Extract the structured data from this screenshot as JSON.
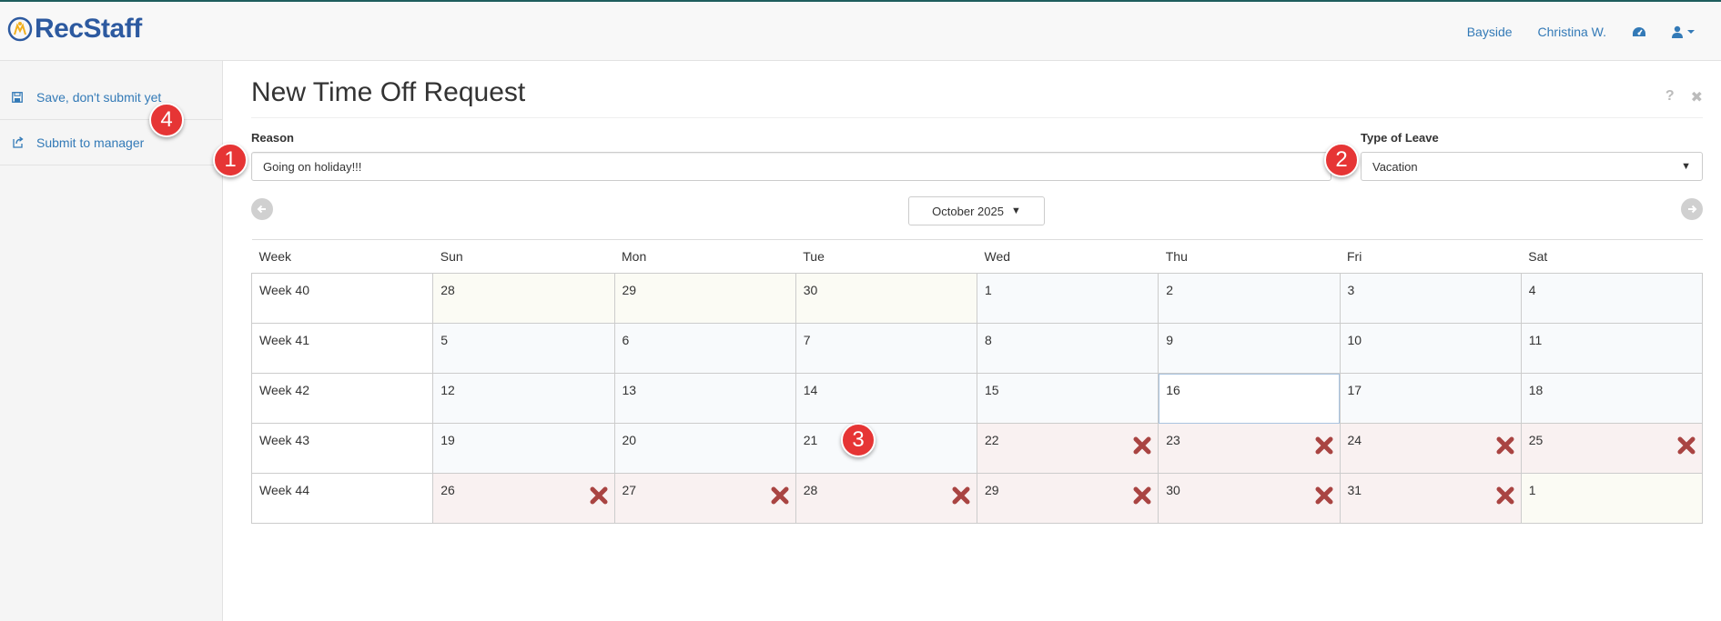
{
  "colors": {
    "link": "#337ab7",
    "brand": "#2d5aa0",
    "time_off_mark": "#a94442",
    "badge": "#e63535"
  },
  "navbar": {
    "brand": "RecStaff",
    "location": "Bayside",
    "user": "Christina W.",
    "icons": [
      "dashboard-icon",
      "user-icon",
      "caret-down-icon"
    ]
  },
  "sidebar": {
    "items": [
      {
        "label": "Save, don't submit yet",
        "icon": "floppy-disk-icon"
      },
      {
        "label": "Submit to manager",
        "icon": "share-icon"
      }
    ]
  },
  "form": {
    "title": "New Time Off Request",
    "reason_label": "Reason",
    "reason_value": "Going on holiday!!!",
    "leave_label": "Type of Leave",
    "leave_value": "Vacation"
  },
  "calendar": {
    "month": "October 2025",
    "headers": [
      "Week",
      "Sun",
      "Mon",
      "Tue",
      "Wed",
      "Thu",
      "Fri",
      "Sat"
    ],
    "weeks": [
      {
        "label": "Week 40",
        "days": [
          "28",
          "29",
          "30",
          "1",
          "2",
          "3",
          "4"
        ]
      },
      {
        "label": "Week 41",
        "days": [
          "5",
          "6",
          "7",
          "8",
          "9",
          "10",
          "11"
        ]
      },
      {
        "label": "Week 42",
        "days": [
          "12",
          "13",
          "14",
          "15",
          "16",
          "17",
          "18"
        ]
      },
      {
        "label": "Week 43",
        "days": [
          "19",
          "20",
          "21",
          "22",
          "23",
          "24",
          "25"
        ]
      },
      {
        "label": "Week 44",
        "days": [
          "26",
          "27",
          "28",
          "29",
          "30",
          "31",
          "1"
        ]
      }
    ]
  },
  "badges": [
    "1",
    "2",
    "3",
    "4"
  ]
}
